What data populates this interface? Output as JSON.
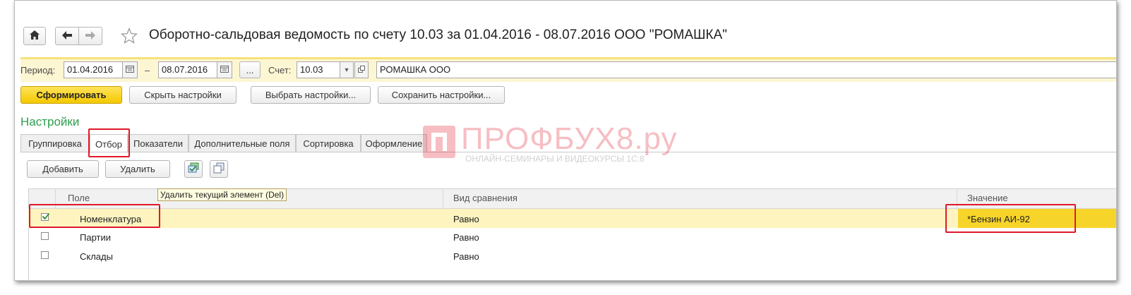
{
  "header": {
    "title": "Оборотно-сальдовая ведомость по счету 10.03 за 01.04.2016 - 08.07.2016 ООО \"РОМАШКА\""
  },
  "params": {
    "period_label": "Период:",
    "date_from": "01.04.2016",
    "dash": "–",
    "date_to": "08.07.2016",
    "ellipsis": "...",
    "account_label": "Счет:",
    "account": "10.03",
    "organization": "РОМАШКА ООО"
  },
  "toolbar": {
    "generate": "Сформировать",
    "hide_settings": "Скрыть настройки",
    "choose_settings": "Выбрать настройки...",
    "save_settings": "Сохранить настройки..."
  },
  "settings": {
    "title": "Настройки",
    "tabs": [
      "Группировка",
      "Отбор",
      "Показатели",
      "Дополнительные поля",
      "Сортировка",
      "Оформление"
    ]
  },
  "filter_toolbar": {
    "add": "Добавить",
    "delete": "Удалить",
    "tooltip": "Удалить текущий элемент (Del)"
  },
  "table": {
    "columns": [
      "Поле",
      "Вид сравнения",
      "Значение"
    ],
    "rows": [
      {
        "checked": true,
        "field": "Номенклатура",
        "comparison": "Равно",
        "value": "*Бензин АИ-92"
      },
      {
        "checked": false,
        "field": "Партии",
        "comparison": "Равно",
        "value": ""
      },
      {
        "checked": false,
        "field": "Склады",
        "comparison": "Равно",
        "value": ""
      }
    ]
  },
  "watermark": {
    "brand": "ПРОФБУХ8.ру",
    "subtitle": "ОНЛАЙН-СЕМИНАРЫ И ВИДЕОКУРСЫ 1С:8"
  },
  "colors": {
    "accent_yellow": "#f4c800",
    "selected_row": "#fdf4c0",
    "settings_green": "#2e9e4f",
    "highlight_red": "#e0182a"
  }
}
